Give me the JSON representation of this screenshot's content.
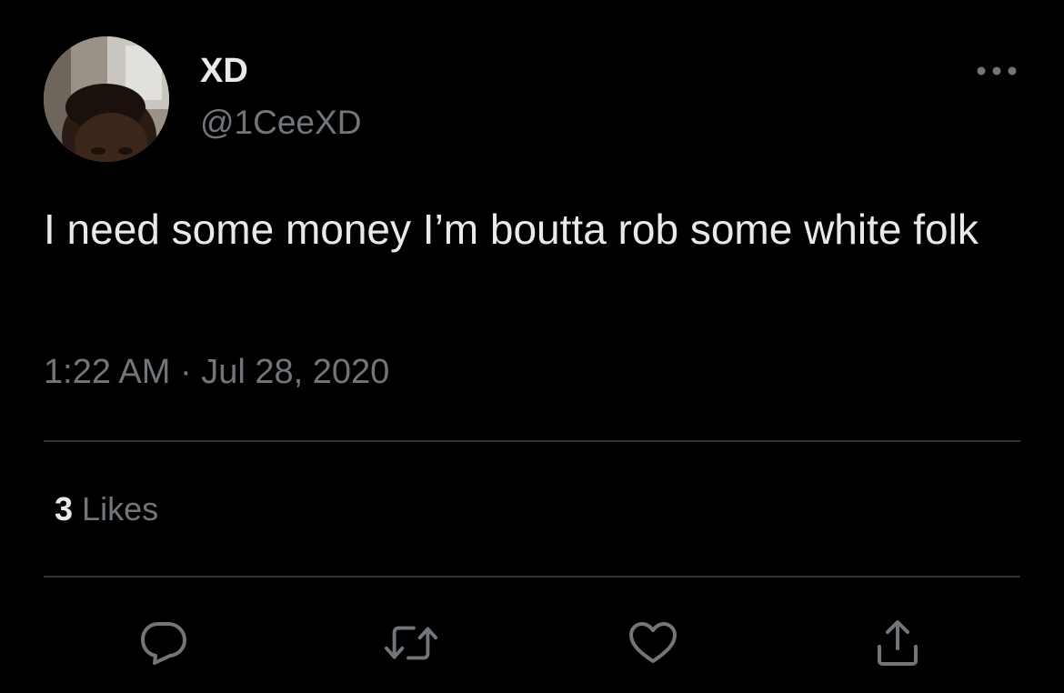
{
  "author": {
    "display_name": "XD",
    "handle": "@1CeeXD",
    "avatar": "user-avatar-photo"
  },
  "tweet": {
    "text": "I need some money I’m boutta rob some white folk",
    "timestamp": "1:22 AM · Jul 28, 2020"
  },
  "stats": {
    "likes_count": "3",
    "likes_label": "Likes"
  },
  "actions": {
    "reply_icon": "reply-icon",
    "retweet_icon": "retweet-icon",
    "like_icon": "heart-icon",
    "share_icon": "share-icon",
    "more_icon": "more-options-icon"
  },
  "colors": {
    "background": "#000000",
    "primary_text": "#e7e9ea",
    "secondary_text": "#71767b",
    "divider": "#2f3336"
  }
}
